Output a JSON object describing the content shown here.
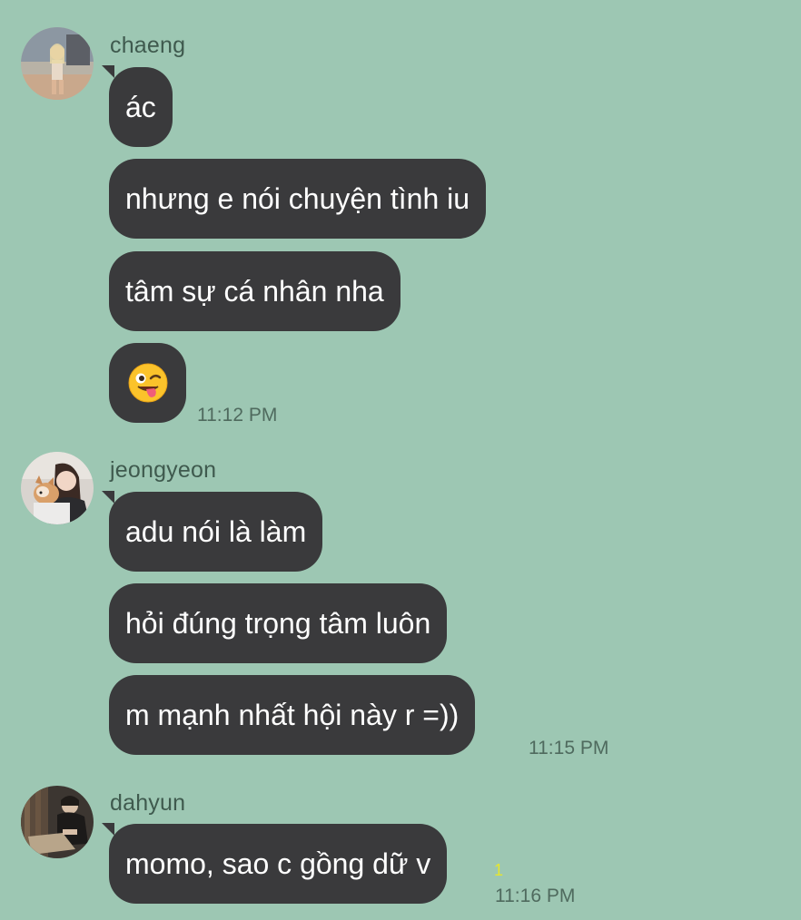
{
  "groups": [
    {
      "sender": "chaeng",
      "messages": [
        "ác",
        "nhưng e nói chuyện tình iu",
        "tâm sự cá nhân nha"
      ],
      "emoji": "winking-face-with-tongue",
      "time": "11:12 PM"
    },
    {
      "sender": "jeongyeon",
      "messages": [
        "adu nói là làm",
        "hỏi đúng trọng tâm luôn",
        "m mạnh nhất hội này r =))"
      ],
      "time": "11:15 PM"
    },
    {
      "sender": "dahyun",
      "messages": [
        "momo, sao c gồng dữ v"
      ],
      "unread": "1",
      "time": "11:16 PM"
    }
  ],
  "colors": {
    "background": "#9dc7b3",
    "bubble": "#3a3a3c",
    "bubble_text": "#ffffff",
    "unread": "#e6e62e"
  }
}
